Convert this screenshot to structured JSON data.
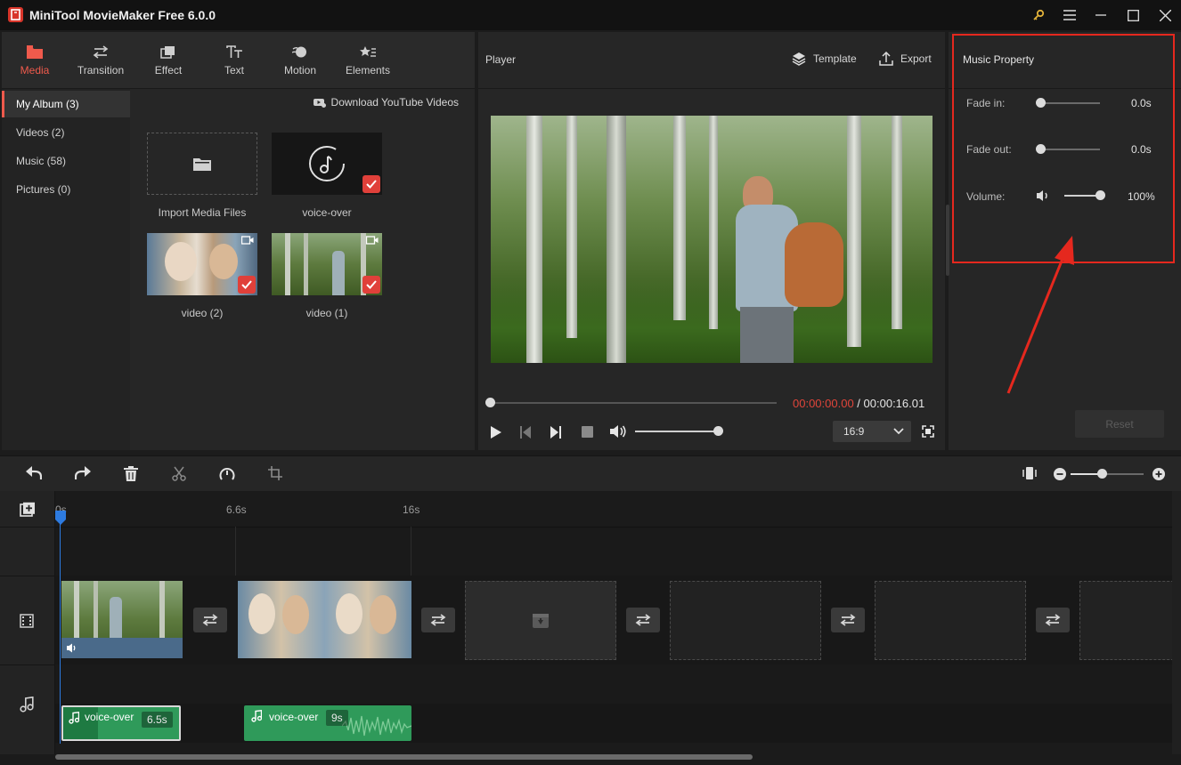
{
  "window": {
    "title": "MiniTool MovieMaker Free 6.0.0"
  },
  "toolbar": {
    "tabs": [
      {
        "label": "Media",
        "icon": "folder-icon"
      },
      {
        "label": "Transition",
        "icon": "swap-icon"
      },
      {
        "label": "Effect",
        "icon": "effect-icon"
      },
      {
        "label": "Text",
        "icon": "text-icon"
      },
      {
        "label": "Motion",
        "icon": "motion-icon"
      },
      {
        "label": "Elements",
        "icon": "elements-icon"
      }
    ]
  },
  "sidebar": {
    "items": [
      {
        "label": "My Album (3)"
      },
      {
        "label": "Videos (2)"
      },
      {
        "label": "Music (58)"
      },
      {
        "label": "Pictures (0)"
      }
    ]
  },
  "media": {
    "download_label": "Download YouTube Videos",
    "items": [
      {
        "label": "Import Media Files"
      },
      {
        "label": "voice-over"
      },
      {
        "label": "video (2)"
      },
      {
        "label": "video (1)"
      }
    ]
  },
  "player": {
    "title": "Player",
    "template_label": "Template",
    "export_label": "Export",
    "current_time": "00:00:00.00",
    "separator": " / ",
    "total_time": "00:00:16.01",
    "aspect": "16:9"
  },
  "property": {
    "title": "Music Property",
    "fade_in_label": "Fade in:",
    "fade_in_value": "0.0s",
    "fade_out_label": "Fade out:",
    "fade_out_value": "0.0s",
    "volume_label": "Volume:",
    "volume_value": "100%",
    "reset_label": "Reset"
  },
  "timeline": {
    "ruler": [
      "0s",
      "6.6s",
      "16s"
    ],
    "audio_clips": [
      {
        "name": "voice-over",
        "duration": "6.5s"
      },
      {
        "name": "voice-over",
        "duration": "9s"
      }
    ]
  },
  "colors": {
    "accent": "#ef5a4c",
    "highlight": "#e5281e",
    "audio": "#2f9a5a",
    "playhead": "#2d7be0"
  }
}
